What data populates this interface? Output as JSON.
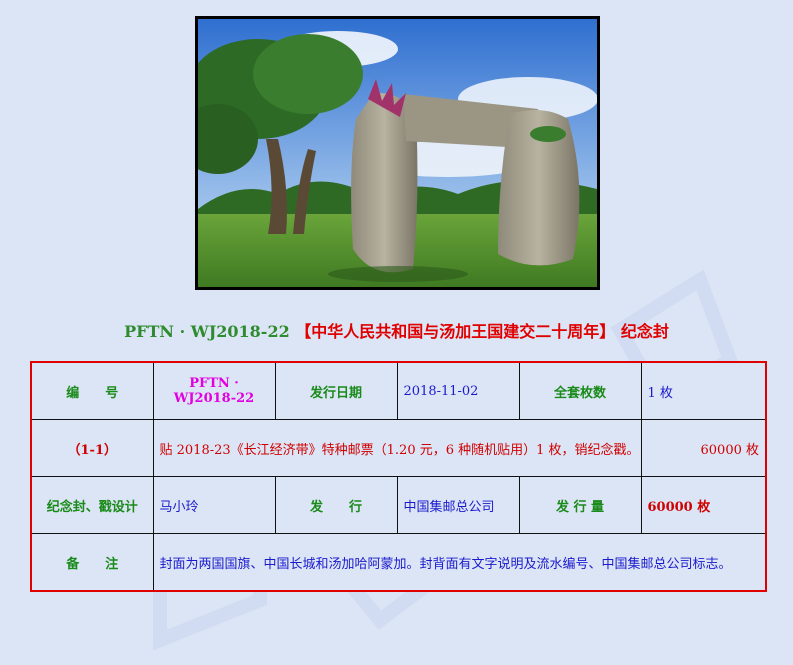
{
  "title": {
    "code": "PFTN · WJ2018-22",
    "name": "【中华人民共和国与汤加王国建交二十周年】",
    "suffix": "纪念封"
  },
  "table": {
    "row1": {
      "label_number": "编　　号",
      "number": "PFTN · WJ2018-22",
      "label_date": "发行日期",
      "date": "2018-11-02",
      "label_set_count": "全套枚数",
      "set_count": "1 枚"
    },
    "row2": {
      "label_item": "（1-1）",
      "description": "贴 2018-23《长江经济带》特种邮票（1.20 元，6 种随机贴用）1 枚，销纪念戳。",
      "quantity": "60000 枚"
    },
    "row3": {
      "label_designer": "纪念封、戳设计",
      "designer": "马小玲",
      "label_issuer": "发　　行",
      "issuer": "中国集邮总公司",
      "label_volume": "发 行 量",
      "volume": "60000 枚"
    },
    "row4": {
      "label_remarks": "备　　注",
      "remarks": "封面为两国国旗、中国长城和汤加哈阿蒙加。封背面有文字说明及流水编号、中国集邮总公司标志。"
    }
  },
  "colors": {
    "background": "#dce5f5",
    "label_green": "#1a8a1a",
    "title_red": "#e00000",
    "value_blue": "#1a1acc",
    "number_magenta": "#e000e0"
  }
}
